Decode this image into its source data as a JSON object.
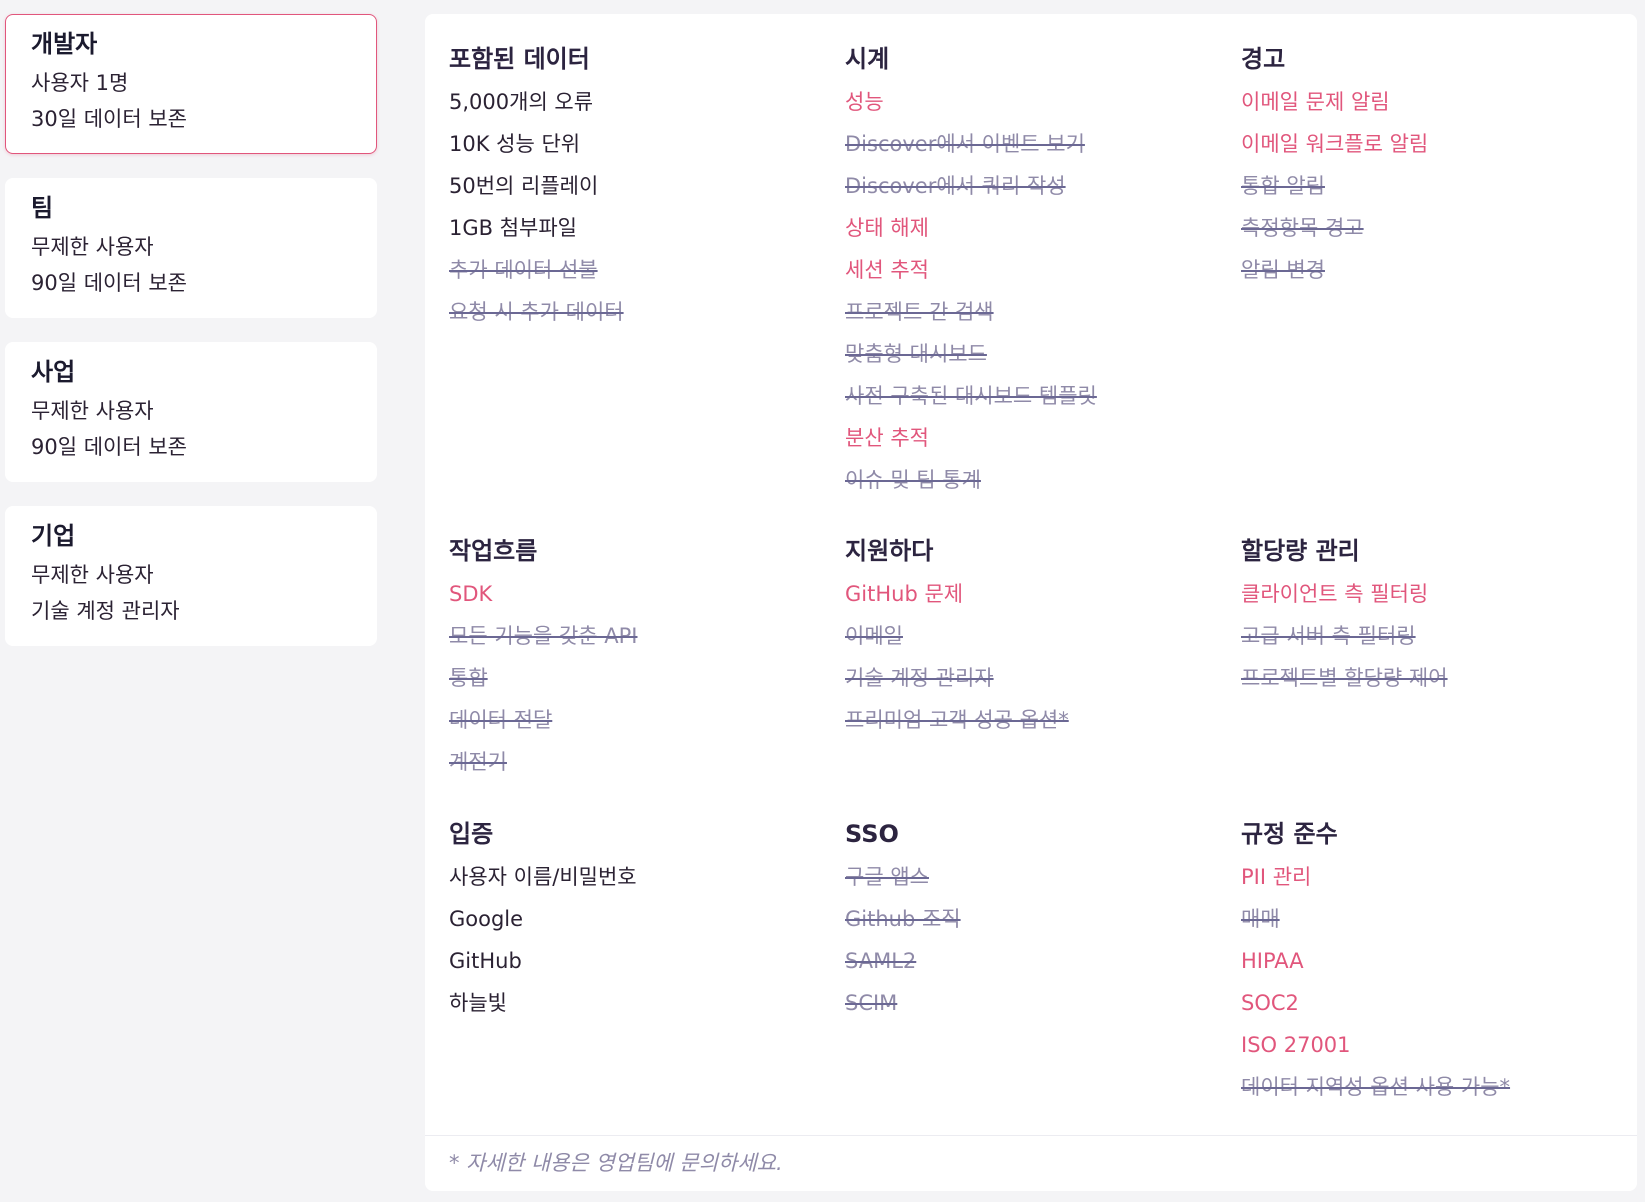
{
  "plans": [
    {
      "name": "개발자",
      "line1": "사용자 1명",
      "line2": "30일 데이터 보존",
      "selected": true
    },
    {
      "name": "팀",
      "line1": "무제한 사용자",
      "line2": "90일 데이터 보존",
      "selected": false
    },
    {
      "name": "사업",
      "line1": "무제한 사용자",
      "line2": "90일 데이터 보존",
      "selected": false
    },
    {
      "name": "기업",
      "line1": "무제한 사용자",
      "line2": "기술 계정 관리자",
      "selected": false
    }
  ],
  "groups": [
    {
      "title": "포함된 데이터",
      "items": [
        {
          "label": "5,000개의 오류",
          "state": "included"
        },
        {
          "label": "10K 성능 단위",
          "state": "included"
        },
        {
          "label": "50번의 리플레이",
          "state": "included"
        },
        {
          "label": "1GB 첨부파일",
          "state": "included"
        },
        {
          "label": "추가 데이터 선불",
          "state": "excluded"
        },
        {
          "label": "요청 시 추가 데이터",
          "state": "excluded"
        }
      ]
    },
    {
      "title": "시계",
      "items": [
        {
          "label": "성능",
          "state": "highlight"
        },
        {
          "label": "Discover에서 이벤트 보기",
          "state": "excluded"
        },
        {
          "label": "Discover에서 쿼리 작성",
          "state": "excluded"
        },
        {
          "label": "상태 해제",
          "state": "highlight"
        },
        {
          "label": "세션 추적",
          "state": "highlight"
        },
        {
          "label": "프로젝트 간 검색",
          "state": "excluded"
        },
        {
          "label": "맞춤형 대시보드",
          "state": "excluded"
        },
        {
          "label": "사전 구축된 대시보드 템플릿",
          "state": "excluded"
        },
        {
          "label": "분산 추적",
          "state": "highlight"
        },
        {
          "label": "이슈 및 팀 통계",
          "state": "excluded"
        }
      ]
    },
    {
      "title": "경고",
      "items": [
        {
          "label": "이메일 문제 알림",
          "state": "highlight"
        },
        {
          "label": "이메일 워크플로 알림",
          "state": "highlight"
        },
        {
          "label": "통합 알림",
          "state": "excluded"
        },
        {
          "label": "측정항목 경고",
          "state": "excluded"
        },
        {
          "label": "알림 변경",
          "state": "excluded"
        }
      ]
    },
    {
      "title": "작업흐름",
      "items": [
        {
          "label": "SDK",
          "state": "highlight"
        },
        {
          "label": "모든 기능을 갖춘 API",
          "state": "excluded"
        },
        {
          "label": "통합",
          "state": "excluded"
        },
        {
          "label": "데이터 전달",
          "state": "excluded"
        },
        {
          "label": "계전기",
          "state": "excluded"
        }
      ]
    },
    {
      "title": "지원하다",
      "items": [
        {
          "label": "GitHub 문제",
          "state": "highlight"
        },
        {
          "label": "이메일",
          "state": "excluded"
        },
        {
          "label": "기술 계정 관리자",
          "state": "excluded"
        },
        {
          "label": "프리미엄 고객 성공 옵션*",
          "state": "excluded"
        }
      ]
    },
    {
      "title": "할당량 관리",
      "items": [
        {
          "label": "클라이언트 측 필터링",
          "state": "highlight"
        },
        {
          "label": "고급 서버 측 필터링",
          "state": "excluded"
        },
        {
          "label": "프로젝트별 할당량 제어",
          "state": "excluded"
        }
      ]
    },
    {
      "title": "입증",
      "items": [
        {
          "label": "사용자 이름/비밀번호",
          "state": "included"
        },
        {
          "label": "Google",
          "state": "included"
        },
        {
          "label": "GitHub",
          "state": "included"
        },
        {
          "label": "하늘빛",
          "state": "included"
        }
      ]
    },
    {
      "title": "SSO",
      "items": [
        {
          "label": "구글 앱스",
          "state": "excluded"
        },
        {
          "label": "Github 조직",
          "state": "excluded"
        },
        {
          "label": "SAML2",
          "state": "excluded"
        },
        {
          "label": "SCIM",
          "state": "excluded"
        }
      ]
    },
    {
      "title": "규정 준수",
      "items": [
        {
          "label": "PII 관리",
          "state": "highlight"
        },
        {
          "label": "매매",
          "state": "excluded"
        },
        {
          "label": "HIPAA",
          "state": "highlight"
        },
        {
          "label": "SOC2",
          "state": "highlight"
        },
        {
          "label": "ISO 27001",
          "state": "highlight"
        },
        {
          "label": "데이터 지역성 옵션 사용 가능*",
          "state": "excluded"
        }
      ]
    }
  ],
  "footnote": "* 자세한 내용은 영업팀에 문의하세요.",
  "colors": {
    "accent": "#e1567c",
    "text": "#2b2233",
    "muted": "#8f8aa8",
    "background": "#f4f4f6"
  }
}
